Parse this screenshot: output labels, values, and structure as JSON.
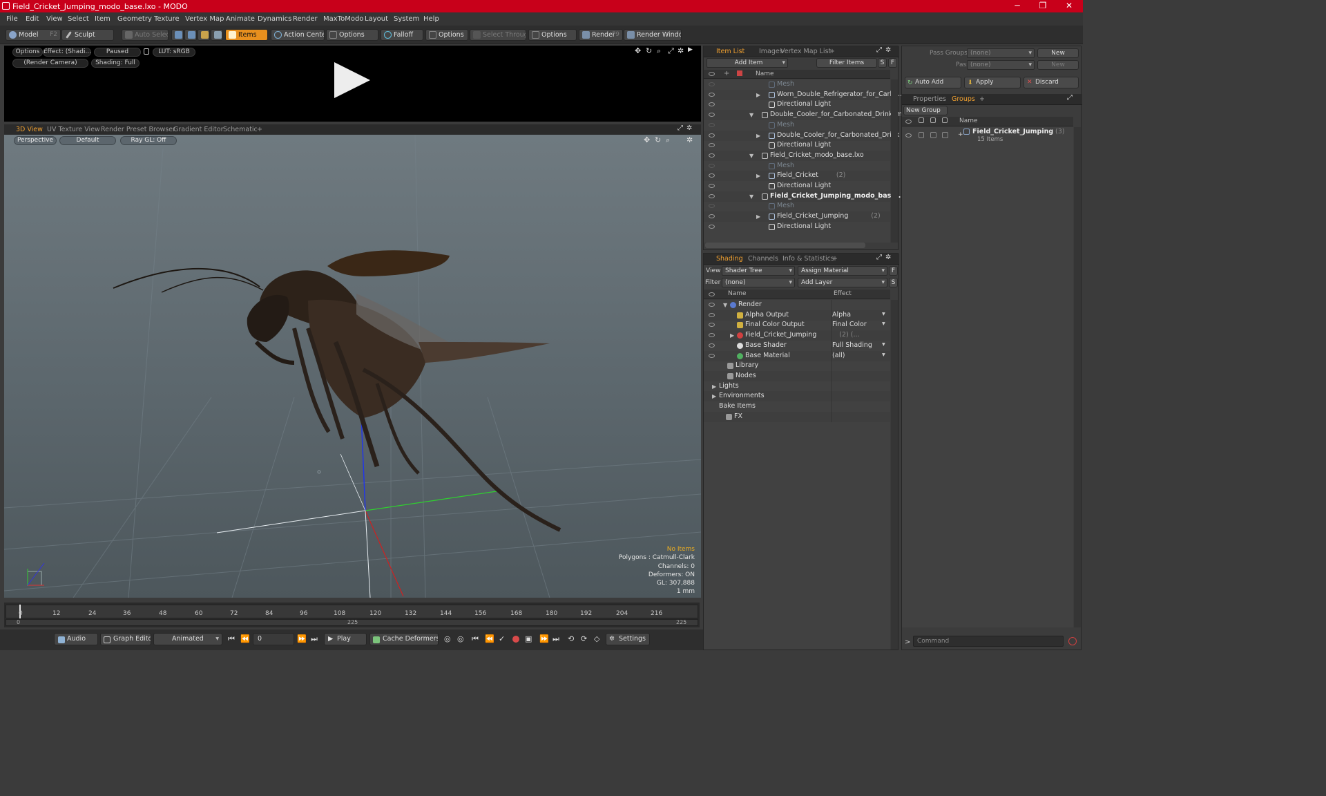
{
  "window": {
    "title": "Field_Cricket_Jumping_modo_base.lxo - MODO",
    "minimize": "─",
    "maximize": "❐",
    "close": "✕"
  },
  "menu": [
    "File",
    "Edit",
    "View",
    "Select",
    "Item",
    "Geometry",
    "Texture",
    "Vertex Map",
    "Animate",
    "Dynamics",
    "Render",
    "MaxToModo",
    "Layout",
    "System",
    "Help"
  ],
  "toolbar": {
    "model": "Model",
    "model_key": "F2",
    "sculpt": "Sculpt",
    "auto_select": "Auto Select",
    "items": "Items",
    "action_center": "Action Center",
    "options1": "Options",
    "falloff": "Falloff",
    "options2": "Options",
    "select_through": "Select Through",
    "options3": "Options",
    "render": "Render",
    "render_key": "F9",
    "render_window": "Render Window"
  },
  "preview": {
    "options": "Options",
    "effect": "Effect: (Shadi...",
    "paused": "Paused",
    "lut": "LUT: sRGB",
    "camera": "(Render Camera)",
    "shading": "Shading: Full"
  },
  "viewport_tabs": [
    "3D View",
    "UV Texture View",
    "Render Preset Browser",
    "Gradient Editor",
    "Schematic",
    "+"
  ],
  "viewport": {
    "perspective": "Perspective",
    "default": "Default",
    "raygl": "Ray GL: Off"
  },
  "stats": {
    "no_items": "No Items",
    "polygons": "Polygons : Catmull-Clark",
    "channels": "Channels: 0",
    "deformers": "Deformers: ON",
    "gl": "GL: 307,888",
    "unit": "1 mm"
  },
  "timeline": {
    "ticks": [
      "0",
      "12",
      "24",
      "36",
      "48",
      "60",
      "72",
      "84",
      "96",
      "108",
      "120",
      "132",
      "144",
      "156",
      "168",
      "180",
      "192",
      "204",
      "216"
    ],
    "sub_left": "0",
    "sub_mid": "225",
    "sub_right": "225"
  },
  "bottom": {
    "audio": "Audio",
    "graph_editor": "Graph Editor",
    "animated": "Animated",
    "frame": "0",
    "play": "Play",
    "cache": "Cache Deformers",
    "settings": "Settings"
  },
  "item_list": {
    "tabs": [
      "Item List",
      "Images",
      "Vertex Map List",
      "+"
    ],
    "add_item": "Add Item",
    "filter_items": "Filter Items",
    "s": "S",
    "f": "F",
    "col_name": "Name",
    "rows": [
      {
        "label": "Mesh",
        "count": "",
        "ghost": true,
        "bold": false
      },
      {
        "label": "Worn_Double_Refrigerator_for_Carbo...",
        "count": "",
        "ghost": false,
        "bold": false
      },
      {
        "label": "Directional Light",
        "count": "",
        "ghost": false,
        "bold": false
      },
      {
        "label": "Double_Cooler_for_Carbonated_Drink_m...",
        "count": "",
        "ghost": false,
        "bold": false
      },
      {
        "label": "Mesh",
        "count": "",
        "ghost": true,
        "bold": false
      },
      {
        "label": "Double_Cooler_for_Carbonated_Drink ...",
        "count": "",
        "ghost": false,
        "bold": false
      },
      {
        "label": "Directional Light",
        "count": "",
        "ghost": false,
        "bold": false
      },
      {
        "label": "Field_Cricket_modo_base.lxo",
        "count": "",
        "ghost": false,
        "bold": false
      },
      {
        "label": "Mesh",
        "count": "",
        "ghost": true,
        "bold": false
      },
      {
        "label": "Field_Cricket",
        "count": "(2)",
        "ghost": false,
        "bold": false
      },
      {
        "label": "Directional Light",
        "count": "",
        "ghost": false,
        "bold": false
      },
      {
        "label": "Field_Cricket_Jumping_modo_bas ...",
        "count": "",
        "ghost": false,
        "bold": true
      },
      {
        "label": "Mesh",
        "count": "",
        "ghost": true,
        "bold": false
      },
      {
        "label": "Field_Cricket_Jumping",
        "count": "(2)",
        "ghost": false,
        "bold": false
      },
      {
        "label": "Directional Light",
        "count": "",
        "ghost": false,
        "bold": false
      }
    ]
  },
  "shading": {
    "tabs": [
      "Shading",
      "Channels",
      "Info & Statistics",
      "+"
    ],
    "view_label": "View",
    "view_value": "Shader Tree",
    "assign_material": "Assign Material",
    "f": "F",
    "filter_label": "Filter",
    "filter_value": "(none)",
    "add_layer": "Add Layer",
    "s": "S",
    "col_name": "Name",
    "col_effect": "Effect",
    "rows": [
      {
        "label": "Render",
        "effect": ""
      },
      {
        "label": "Alpha Output",
        "effect": "Alpha"
      },
      {
        "label": "Final Color Output",
        "effect": "Final Color"
      },
      {
        "label": "Field_Cricket_Jumping",
        "count": "(2) (...",
        "effect": ""
      },
      {
        "label": "Base Shader",
        "effect": "Full Shading"
      },
      {
        "label": "Base Material",
        "effect": "(all)"
      },
      {
        "label": "Library",
        "effect": ""
      },
      {
        "label": "Nodes",
        "effect": ""
      },
      {
        "label": "Lights",
        "effect": ""
      },
      {
        "label": "Environments",
        "effect": ""
      },
      {
        "label": "Bake Items",
        "effect": ""
      },
      {
        "label": "FX",
        "effect": ""
      }
    ]
  },
  "groups": {
    "pass_groups": "Pass Groups",
    "pass_value": "(none)",
    "new1": "New",
    "passes": "Passes",
    "passes_value": "(none)",
    "new2": "New",
    "auto_add": "Auto Add",
    "apply": "Apply",
    "discard": "Discard",
    "tabs": [
      "Properties",
      "Groups",
      "+"
    ],
    "new_group": "New Group",
    "col_name": "Name",
    "group_name": "Field_Cricket_Jumping",
    "group_count": "(3)",
    "group_items": "15 Items"
  },
  "command": {
    "placeholder": "Command",
    "prompt": ">"
  }
}
